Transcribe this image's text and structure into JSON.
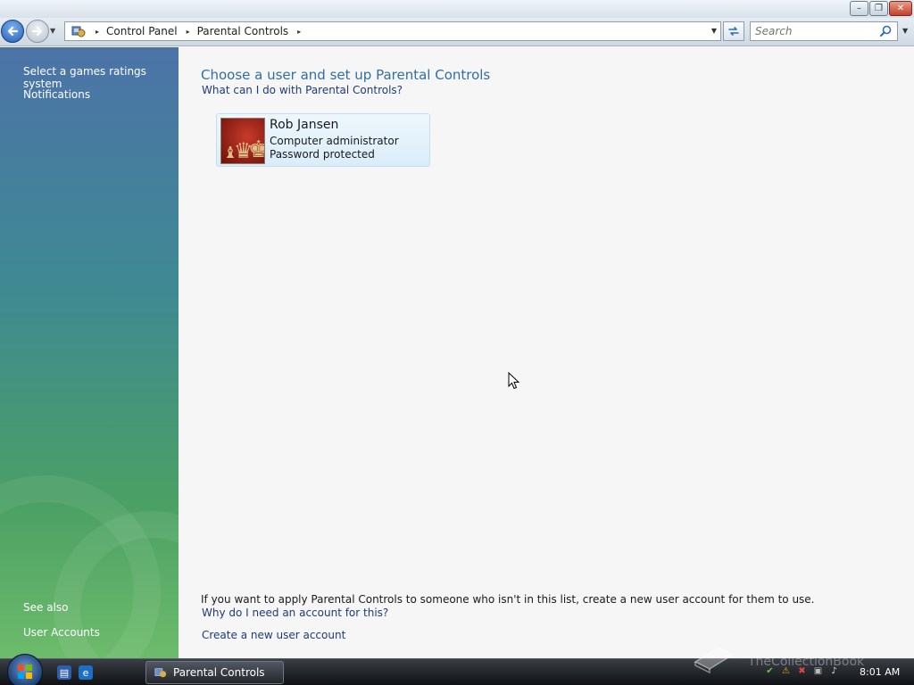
{
  "window": {
    "minimize_glyph": "–",
    "maximize_glyph": "❐",
    "close_glyph": "✕"
  },
  "addressbar": {
    "crumbs": [
      "Control Panel",
      "Parental Controls"
    ],
    "search_placeholder": "Search"
  },
  "sidebar": {
    "tasks": [
      "Select a games ratings system",
      "Notifications"
    ],
    "see_also_title": "See also",
    "see_also_items": [
      "User Accounts"
    ]
  },
  "main": {
    "heading": "Choose a user and set up Parental Controls",
    "help_link": "What can I do with Parental Controls?",
    "users": [
      {
        "name": "Rob Jansen",
        "role": "Computer administrator",
        "status": "Password protected"
      }
    ],
    "info_text": "If you want to apply Parental Controls to someone who isn't in this list, create a new user  account for them to use.",
    "why_link": "Why do I need an account for this?",
    "create_link": "Create a new user account"
  },
  "taskbar": {
    "window_button": "Parental Controls",
    "clock": "8:01 AM",
    "watermark": "TheCollectionBook"
  },
  "icons": {
    "back": "back-arrow-icon",
    "forward": "forward-arrow-icon",
    "refresh": "refresh-icon",
    "search": "magnifier-icon",
    "start": "windows-orb-icon"
  },
  "colors": {
    "heading": "#2f6fa6",
    "link": "#1e3b78",
    "sidebar_top": "#4c73a8",
    "sidebar_bottom": "#6dbb6b"
  }
}
